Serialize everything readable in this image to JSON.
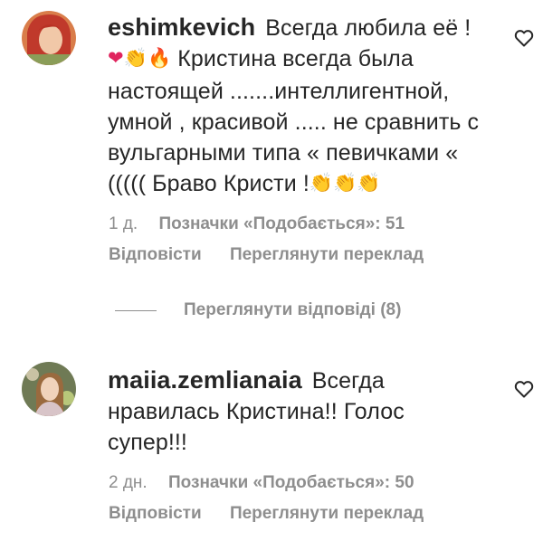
{
  "comments": [
    {
      "username": "eshimkevich",
      "line1": "Всегда любила её !",
      "line2_text": "Кристина всегда была",
      "line2_emojis": [
        "❤",
        "👏",
        "🔥"
      ],
      "line3": "настоящей .......интеллигентной,",
      "line4": "умной , красивой ..... не сравнить с",
      "line5": "вульгарными типа « певичками «",
      "line6_text": "((((( Браво Кристи !",
      "line6_emojis": [
        "👏",
        "👏",
        "👏"
      ],
      "time": "1 д.",
      "likes": "Позначки «Подобається»: 51",
      "reply": "Відповісти",
      "translate": "Переглянути переклад",
      "like_icon": "heart-outline-icon"
    },
    {
      "username": "maiia.zemlianaia",
      "line1": "Всегда",
      "line2": "нравилась Кристина!! Голос",
      "line3": "супер!!!",
      "time": "2 дн.",
      "likes": "Позначки «Подобається»: 50",
      "reply": "Відповісти",
      "translate": "Переглянути переклад",
      "like_icon": "heart-outline-icon"
    }
  ],
  "view_replies": "Переглянути відповіді (8)",
  "colors": {
    "text": "#262626",
    "secondary": "#8e8e8e",
    "heart": "#e0245e",
    "clap": "#f2b632"
  }
}
